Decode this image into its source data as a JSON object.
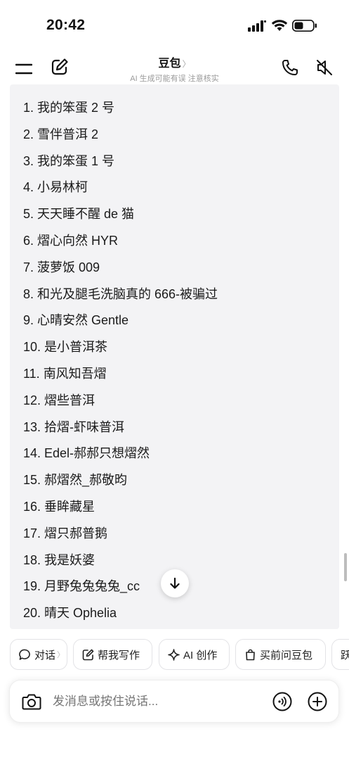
{
  "status_bar": {
    "time": "20:42"
  },
  "header": {
    "title": "豆包",
    "title_chevron": "〉",
    "subtitle": "AI 生成可能有误 注意核实"
  },
  "message": {
    "items": [
      "1.  我的笨蛋 2 号",
      "2.  雪伴普洱 2",
      "3.  我的笨蛋 1 号",
      "4.  小易林柯",
      "5.  天天睡不醒 de 猫",
      "6.  熠心向然 HYR",
      "7.  菠萝饭 009",
      "8.  和光及腿毛洗脑真的 666-被骗过",
      "9.  心晴安然 Gentle",
      "10.  是小普洱茶",
      "11.  南风知吾熠",
      "12.  熠些普洱",
      "13.  拾熠-虾味普洱",
      "14.  Edel-郝郝只想熠然",
      "15.  郝熠然_郝敬昀",
      "16.  垂眸藏星",
      "17.  熠只郝普鹅",
      "18.  我是妖婆",
      "19.  月野兔兔兔兔_cc",
      "20.  晴天 Ophelia"
    ]
  },
  "quick_actions": [
    {
      "label": "对话",
      "icon": "chat-bubble-icon"
    },
    {
      "label": "帮我写作",
      "icon": "pen-square-icon"
    },
    {
      "label": "AI 创作",
      "icon": "sparkle-icon"
    },
    {
      "label": "买前问豆包",
      "icon": "shopping-bag-icon"
    },
    {
      "label": "跃",
      "icon": ""
    }
  ],
  "quick_actions_chevron": "〉",
  "input": {
    "placeholder": "发消息或按住说话..."
  }
}
